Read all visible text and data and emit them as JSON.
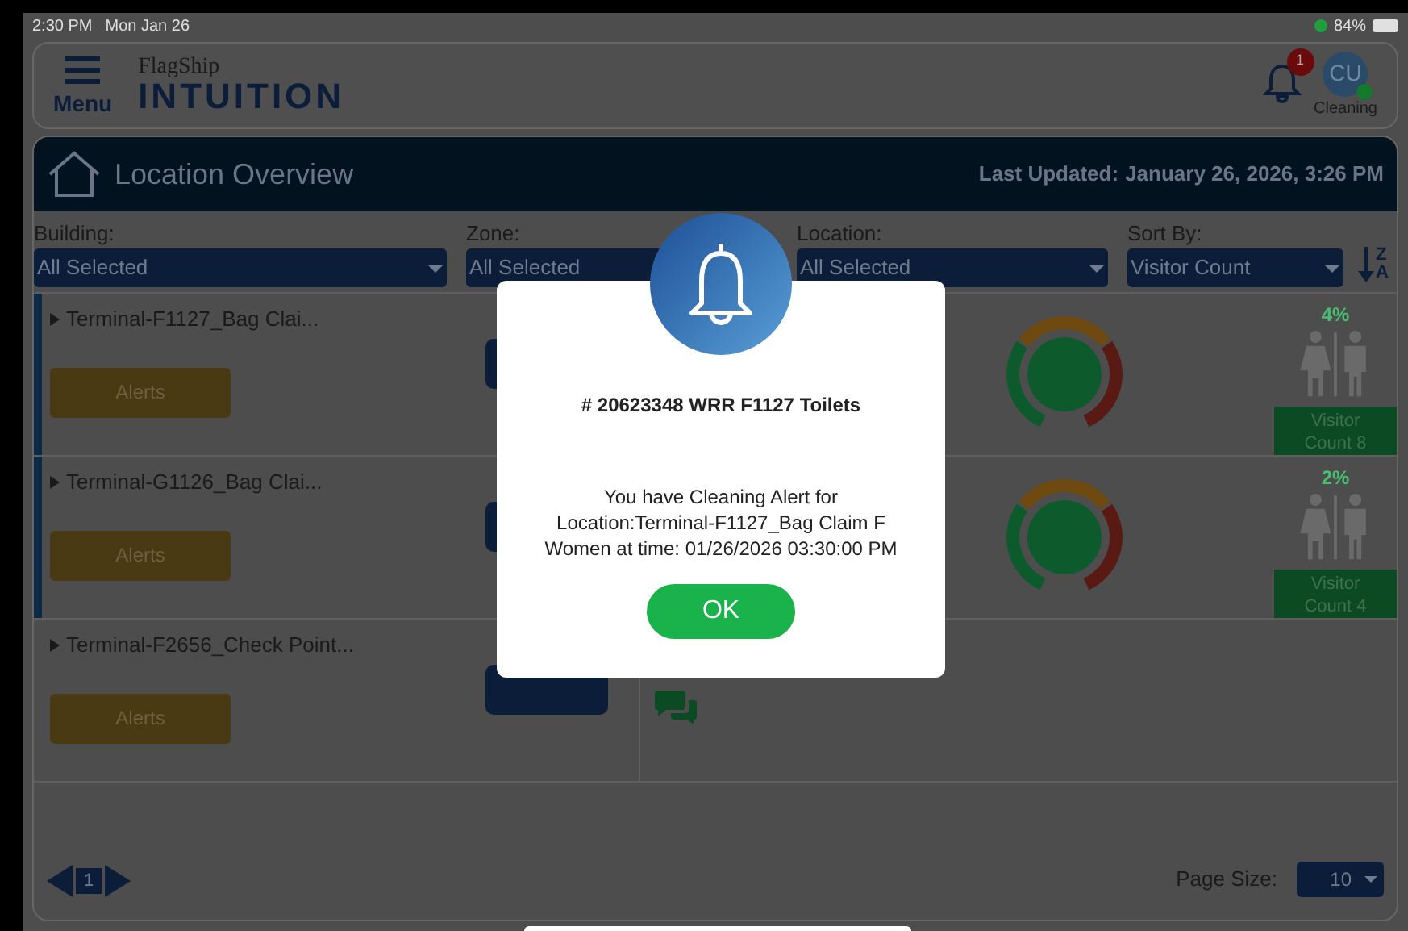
{
  "status_bar": {
    "time": "2:30 PM",
    "date": "Mon Jan 26",
    "battery": "84%"
  },
  "header": {
    "menu_label": "Menu",
    "brand_small": "FlagShip",
    "brand": "INTUITION",
    "notification_count": "1",
    "avatar": "CU",
    "role": "Cleaning"
  },
  "title_bar": {
    "title": "Location Overview",
    "updated_label": "Last Updated:",
    "updated": "January 26, 2026, 3:26 PM"
  },
  "filters": [
    {
      "label": "Building:",
      "value": "All Selected"
    },
    {
      "label": "Zone:",
      "value": "All Selected"
    },
    {
      "label": "Location:",
      "value": "All Selected"
    },
    {
      "label": "Sort By:",
      "value": "Visitor Count"
    }
  ],
  "sort_letters": [
    "Z",
    "A"
  ],
  "rows": [
    {
      "name": "Terminal-F1127_Bag Clai...",
      "alerts": "Alerts",
      "active": true,
      "kind": "gauge",
      "percent": "4%",
      "visitors": "Visitor Count 8"
    },
    {
      "name": "Terminal-G1126_Bag Clai...",
      "alerts": "Alerts",
      "active": true,
      "kind": "gauge",
      "percent": "2%",
      "visitors": "Visitor Count 4"
    },
    {
      "name": "Terminal-F2656_Check Point...",
      "alerts": "Alerts",
      "active": false,
      "kind": "feedback"
    }
  ],
  "pagination": {
    "page": "1",
    "page_size_label": "Page Size:",
    "page_size": "10"
  },
  "modal": {
    "title": "# 20623348 WRR F1127 Toilets",
    "message": [
      "You have Cleaning Alert for",
      "Location:Terminal-F1127_Bag Claim F",
      "Women at time: 01/26/2026 03:30:00 PM"
    ],
    "ok": "OK"
  }
}
